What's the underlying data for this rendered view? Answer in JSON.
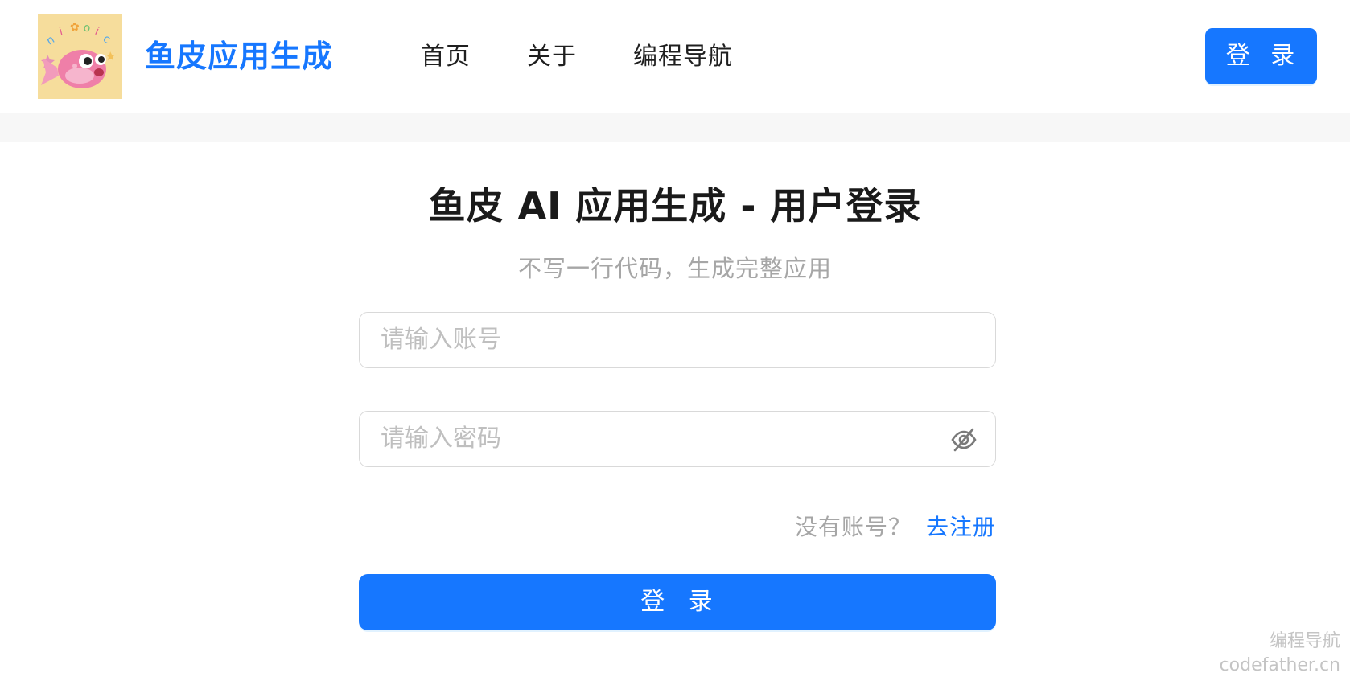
{
  "header": {
    "brand": "鱼皮应用生成",
    "nav": [
      "首页",
      "关于",
      "编程导航"
    ],
    "login_button": "登 录"
  },
  "main": {
    "title": "鱼皮 AI 应用生成 - 用户登录",
    "subtitle": "不写一行代码，生成完整应用",
    "account_placeholder": "请输入账号",
    "password_placeholder": "请输入密码",
    "register_hint": "没有账号？",
    "register_link": "去注册",
    "submit_button": "登 录"
  },
  "watermark": {
    "line1": "编程导航",
    "line2": "codefather.cn"
  },
  "colors": {
    "primary": "#1677ff",
    "text": "#1a1a1a",
    "muted": "#a6a6a6",
    "border": "#d9d9d9"
  },
  "icons": {
    "logo": "fish-logo",
    "password_toggle": "eye-invisible-icon"
  }
}
